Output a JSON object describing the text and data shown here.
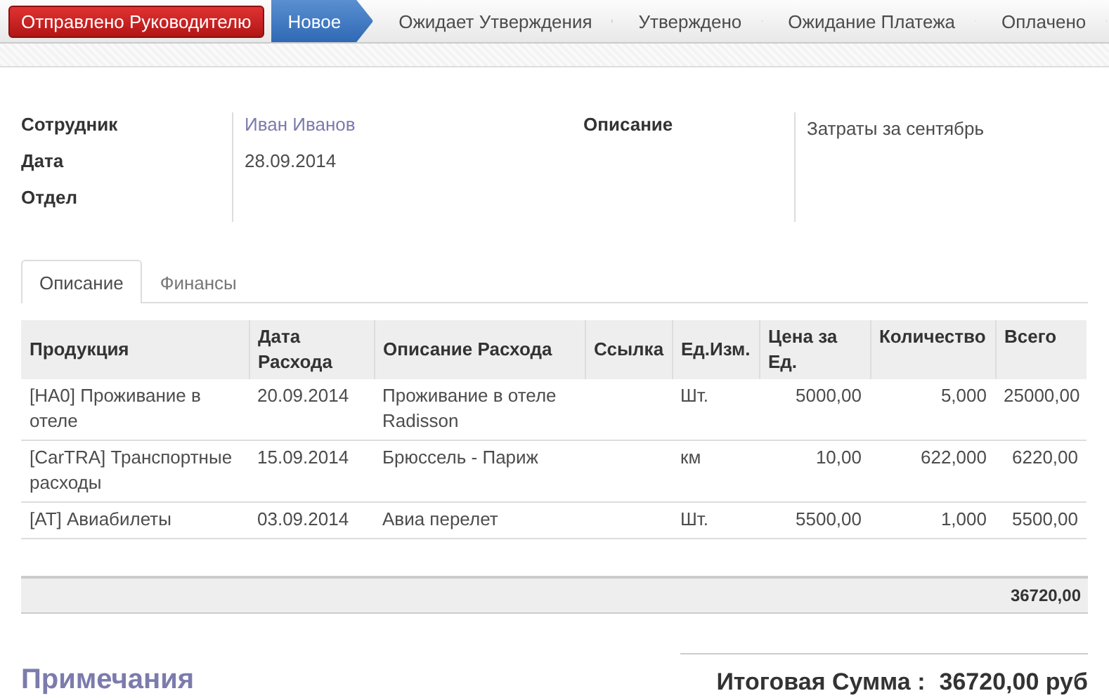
{
  "header": {
    "action_button": "Отправлено Руководителю",
    "stages": [
      {
        "label": "Новое",
        "selected": true
      },
      {
        "label": "Ожидает Утверждения",
        "selected": false
      },
      {
        "label": "Утверждено",
        "selected": false
      },
      {
        "label": "Ожидание Платежа",
        "selected": false
      },
      {
        "label": "Оплачено",
        "selected": false
      }
    ]
  },
  "form": {
    "left_fields": [
      {
        "label": "Сотрудник",
        "value": "Иван Иванов",
        "link": true
      },
      {
        "label": "Дата",
        "value": "28.09.2014",
        "link": false
      },
      {
        "label": "Отдел"
      }
    ],
    "right_fields": [
      {
        "label": "Описание",
        "value": "Затраты за сентябрь",
        "link": false
      }
    ]
  },
  "tabs": [
    {
      "label": "Описание",
      "selected": true
    },
    {
      "label": "Финансы",
      "selected": false
    }
  ],
  "table": {
    "columns": [
      "Продукция",
      "Дата Расхода",
      "Описание Расхода",
      "Ссылка",
      "Ед.Изм.",
      "Цена за Ед.",
      "Количество",
      "Всего"
    ],
    "rows": [
      [
        "[HA0] Проживание в отеле",
        "20.09.2014",
        "Проживание в отеле Radisson",
        "",
        "Шт.",
        "5000,00",
        "5,000",
        "25000,00"
      ],
      [
        "[CarTRA] Транспортные расходы",
        "15.09.2014",
        "Брюссель - Париж",
        "",
        "км",
        "10,00",
        "622,000",
        "6220,00"
      ],
      [
        "[AT] Авиабилеты",
        "03.09.2014",
        "Авиа перелет",
        "",
        "Шт.",
        "5500,00",
        "1,000",
        "5500,00"
      ]
    ],
    "footer_total": "36720,00"
  },
  "notes_title": "Примечания",
  "total": {
    "label": "Итоговая Сумма :",
    "value": "36720,00 руб"
  }
}
